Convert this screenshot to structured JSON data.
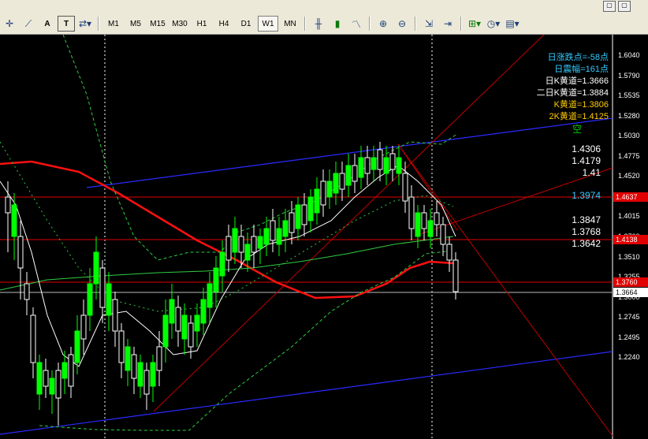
{
  "toolbar": {
    "timeframes": [
      "M1",
      "M5",
      "M15",
      "M30",
      "H1",
      "H4",
      "D1",
      "W1",
      "MN"
    ],
    "active_timeframe": "W1",
    "text_tool_label": "A",
    "text_label_tool": "T",
    "window_controls": [
      "▢",
      "▢"
    ]
  },
  "info_panel": [
    {
      "text": "日涨跌点=-58点",
      "color": "#33ccff"
    },
    {
      "text": "日震幅=161点",
      "color": "#33ccff"
    },
    {
      "text": "日K黄道=1.3666",
      "color": "#ffffff"
    },
    {
      "text": "二日K黄道=1.3884",
      "color": "#ffffff"
    },
    {
      "text": "K黄道=1.3806",
      "color": "#ffcc00"
    },
    {
      "text": "2K黄道=1.4125",
      "color": "#ffcc00"
    },
    {
      "text": "空",
      "color": "#00cc00"
    }
  ],
  "levels": [
    {
      "text": "1.4306",
      "color": "#ffffff"
    },
    {
      "text": "1.4179",
      "color": "#ffffff"
    },
    {
      "text": "1.41",
      "color": "#ffffff"
    },
    {
      "text": "1.3974",
      "color": "#33ccff"
    },
    {
      "text": "1.3847",
      "color": "#ffffff"
    },
    {
      "text": "1.3768",
      "color": "#ffffff"
    },
    {
      "text": "1.3642",
      "color": "#ffffff"
    }
  ],
  "price_axis": [
    "1.6040",
    "1.5790",
    "1.5535",
    "1.5280",
    "1.5030",
    "1.4775",
    "1.4520",
    "1.4270",
    "1.4015",
    "1.3760",
    "1.3510",
    "1.3255",
    "1.3000",
    "1.2745",
    "1.2495",
    "1.2240"
  ],
  "price_tags": [
    {
      "text": "1.4637",
      "bg": "#e00000",
      "fg": "#ffffff"
    },
    {
      "text": "1.4138",
      "bg": "#e00000",
      "fg": "#ffffff"
    },
    {
      "text": "1.3760",
      "bg": "#e00000",
      "fg": "#ffffff"
    },
    {
      "text": "1.3664",
      "bg": "#ffffff",
      "fg": "#000000"
    }
  ],
  "colors": {
    "bull": "#00ff00",
    "bear": "#ffffff",
    "ma": "#ff1010",
    "channel": "#2a2aff",
    "hline": "#e00000"
  }
}
